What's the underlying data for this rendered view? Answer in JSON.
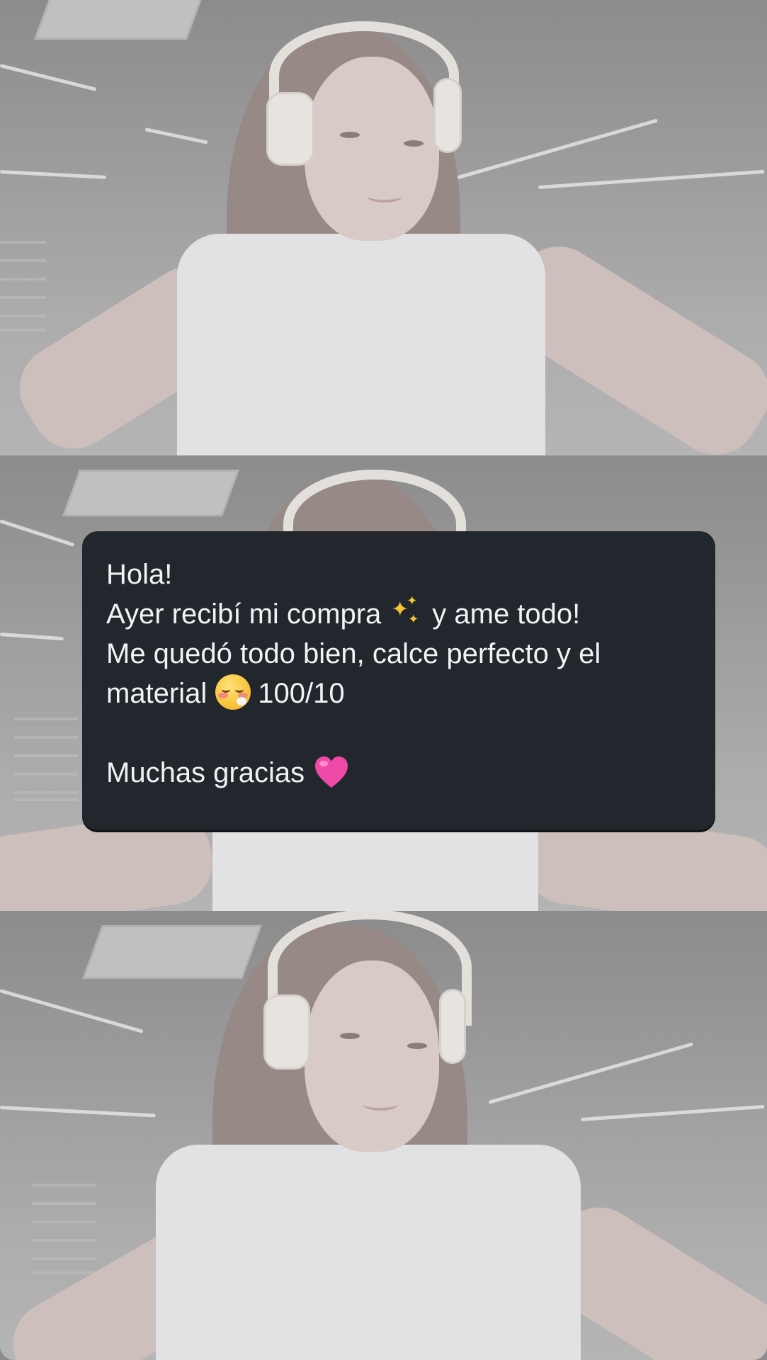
{
  "story": {
    "background_photo": "gym-selfie-photo",
    "overlay_color": "#d7d7d7"
  },
  "message": {
    "line_1": "Hola!",
    "line_2_before_emoji": "Ayer recibí mi compra",
    "line_2_emoji": "sparkles-emoji",
    "line_2_after_emoji": "y ame todo!",
    "line_3": "Me quedó todo bien, calce perfecto y el",
    "line_4_before_emoji": "material",
    "line_4_emoji": "face-exhaling-emoji",
    "line_4_after_emoji": "100/10",
    "line_5_before_emoji": "Muchas gracias",
    "line_5_emoji": "pink-heart-emoji",
    "card_color": "#22262d",
    "text_color": "#f2f2f2"
  }
}
